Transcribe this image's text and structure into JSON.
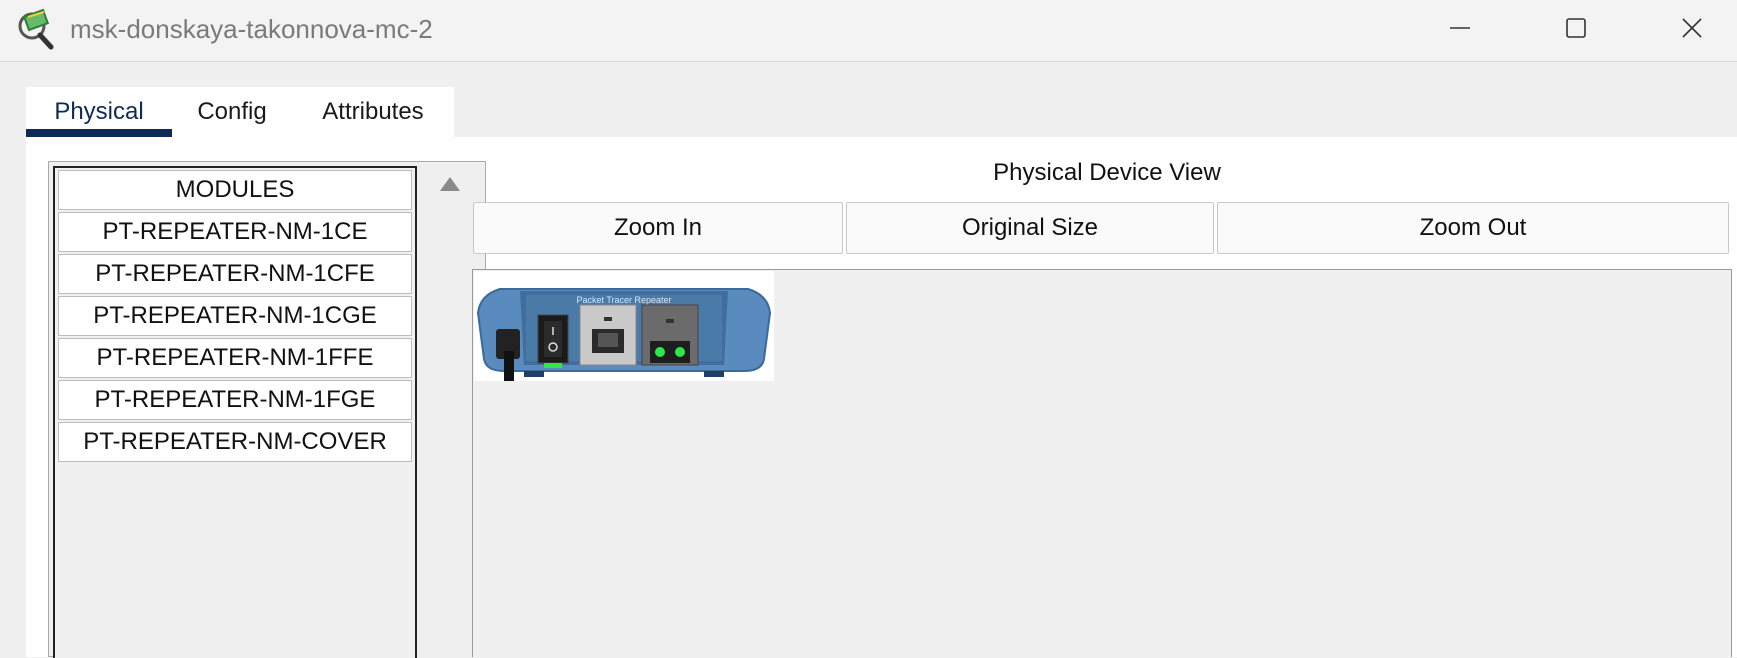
{
  "window": {
    "title": "msk-donskaya-takonnova-mc-2",
    "controls": {
      "minimize_icon": "minimize-icon",
      "maximize_icon": "maximize-icon",
      "close_icon": "close-icon"
    },
    "app_icon": "packet-tracer-icon"
  },
  "tabs": [
    {
      "label": "Physical",
      "active": true
    },
    {
      "label": "Config",
      "active": false
    },
    {
      "label": "Attributes",
      "active": false
    }
  ],
  "modules": {
    "header": "MODULES",
    "items": [
      "PT-REPEATER-NM-1CE",
      "PT-REPEATER-NM-1CFE",
      "PT-REPEATER-NM-1CGE",
      "PT-REPEATER-NM-1FFE",
      "PT-REPEATER-NM-1FGE",
      "PT-REPEATER-NM-COVER"
    ]
  },
  "device_view": {
    "title": "Physical Device View",
    "zoom_in_label": "Zoom In",
    "original_size_label": "Original Size",
    "zoom_out_label": "Zoom Out",
    "device_label": "Packet Tracer Repeater"
  },
  "colors": {
    "accent": "#0e2a55",
    "device_blue": "#5a8bbf",
    "led_green": "#2ee84a"
  }
}
